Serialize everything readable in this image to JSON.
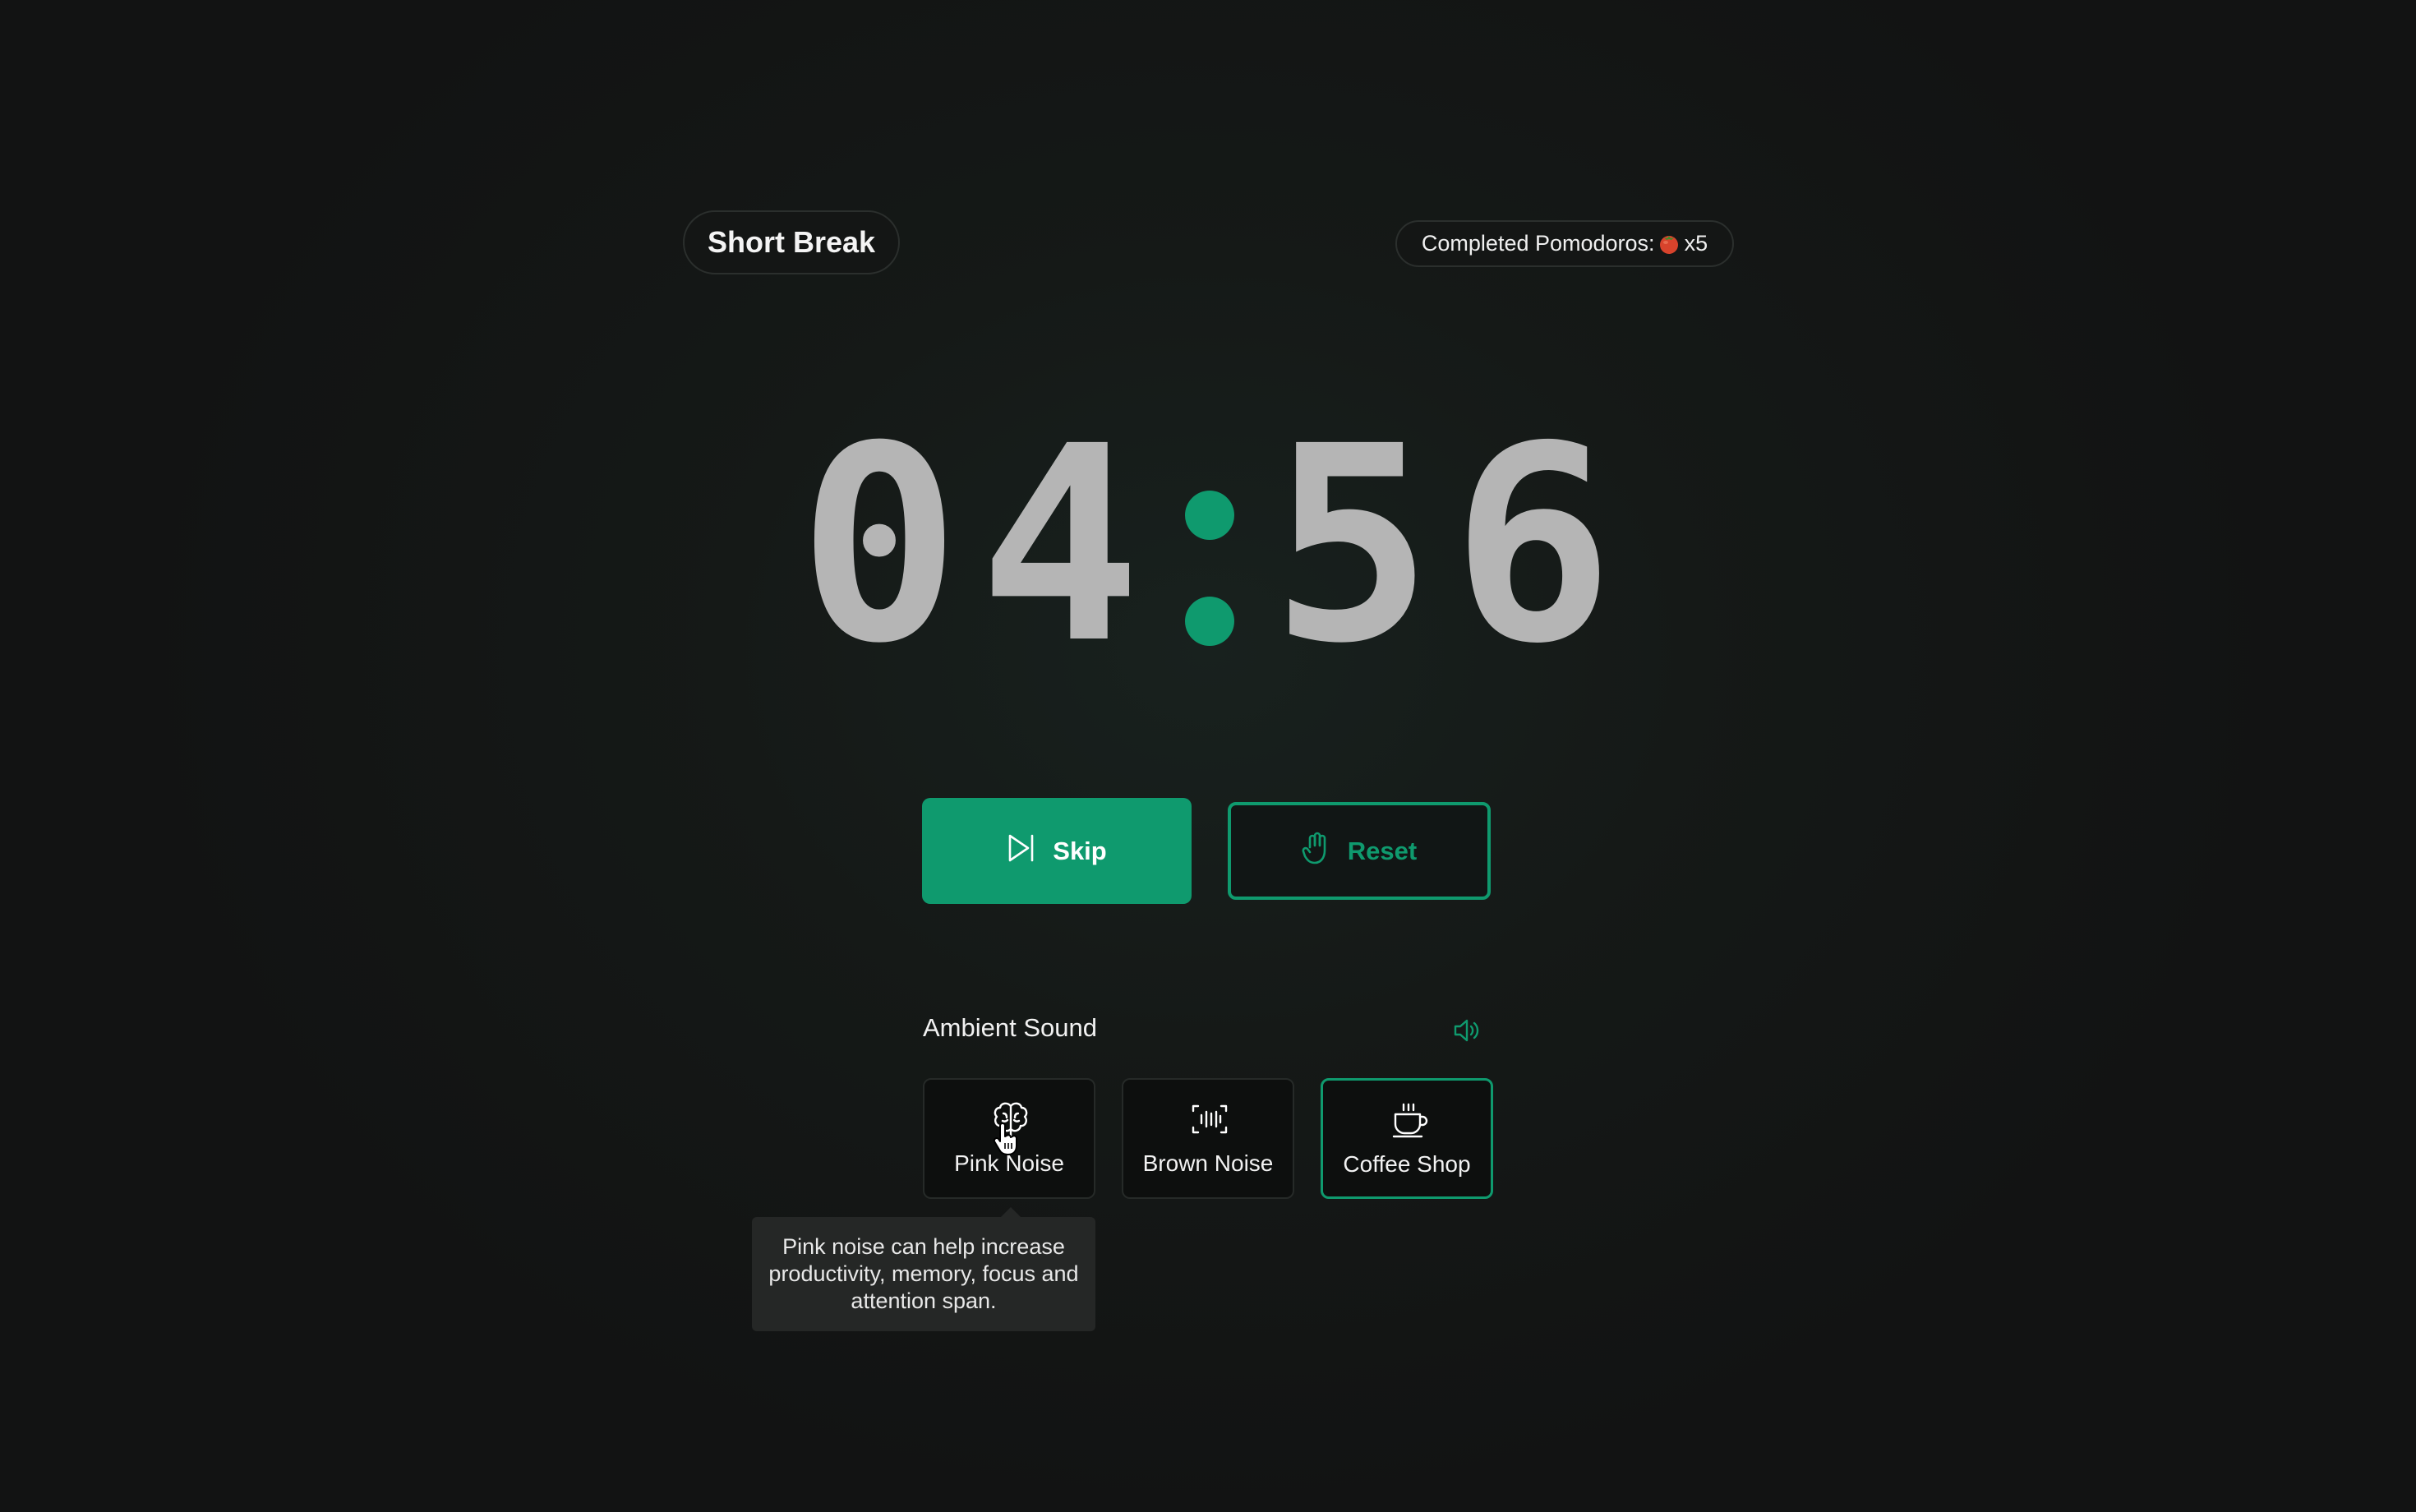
{
  "header": {
    "mode_label": "Short Break",
    "completed_label": "Completed Pomodoros:",
    "completed_count": "x5",
    "tomato_icon": "tomato-icon"
  },
  "timer": {
    "digits": [
      "0",
      "4",
      "5",
      "6"
    ],
    "separator_color": "#0f9a6e",
    "digit_color": "#b5b5b5"
  },
  "controls": {
    "skip_label": "Skip",
    "skip_icon": "skip-icon",
    "reset_label": "Reset",
    "reset_icon": "hand-icon"
  },
  "ambient": {
    "title": "Ambient Sound",
    "volume_icon": "volume-icon",
    "sounds": [
      {
        "label": "Pink Noise",
        "icon": "brain-icon",
        "active": false
      },
      {
        "label": "Brown Noise",
        "icon": "soundwave-icon",
        "active": false
      },
      {
        "label": "Coffee Shop",
        "icon": "coffee-cup-icon",
        "active": true
      }
    ],
    "tooltip": "Pink noise can help increase productivity, memory, focus and attention span."
  },
  "colors": {
    "accent": "#0f9a6e",
    "background": "#131615"
  }
}
